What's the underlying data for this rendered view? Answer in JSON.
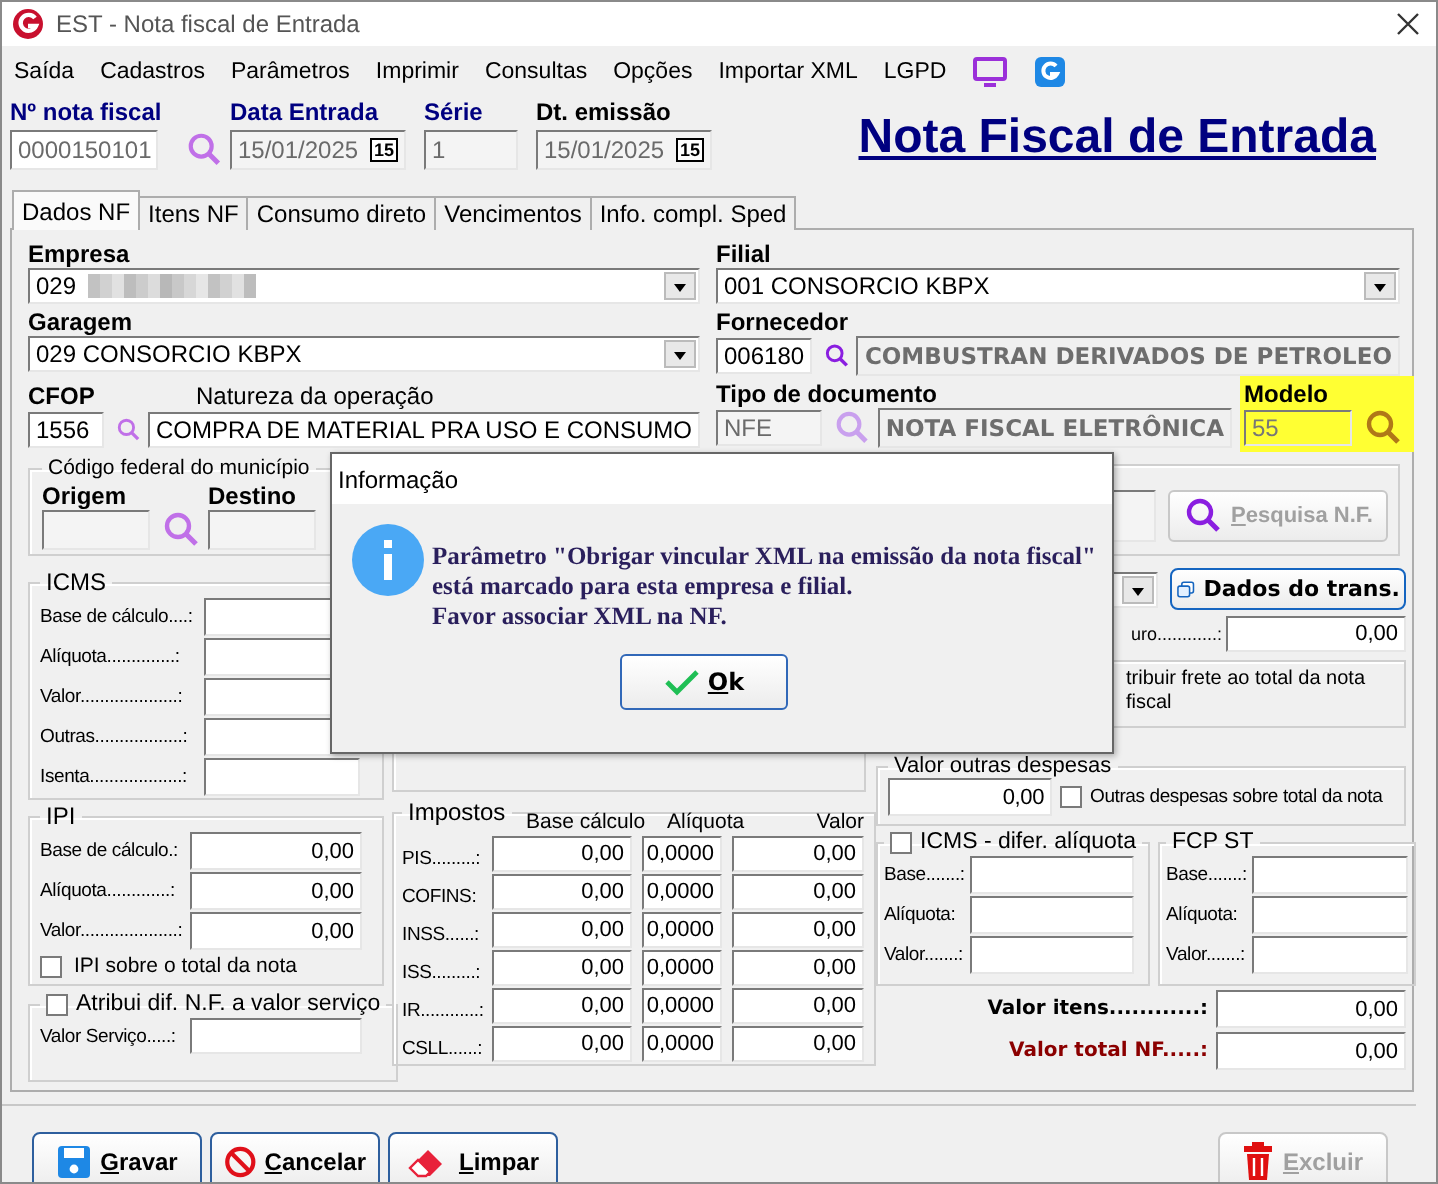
{
  "window": {
    "title": "EST - Nota fiscal de Entrada"
  },
  "menu": [
    "Saída",
    "Cadastros",
    "Parâmetros",
    "Imprimir",
    "Consultas",
    "Opções",
    "Importar XML",
    "LGPD"
  ],
  "header": {
    "fields": [
      {
        "label": "Nº nota fiscal",
        "value": "0000150101",
        "kind": "search",
        "highlighted": true
      },
      {
        "label": "Data Entrada",
        "value": "15/01/2025",
        "kind": "date",
        "highlighted": true,
        "calendar_day": "15"
      },
      {
        "label": "Série",
        "value": "1",
        "kind": "plain",
        "highlighted": true
      },
      {
        "label": "Dt. emissão",
        "value": "15/01/2025",
        "kind": "date",
        "highlighted": false,
        "calendar_day": "15"
      }
    ],
    "title": "Nota Fiscal de Entrada"
  },
  "tabs": [
    {
      "label": "Dados NF",
      "selected": true
    },
    {
      "label": "Itens NF",
      "selected": false
    },
    {
      "label": "Consumo direto",
      "selected": false
    },
    {
      "label": "Vencimentos",
      "selected": false
    },
    {
      "label": "Info. compl. Sped",
      "selected": false
    }
  ],
  "empresa": {
    "label": "Empresa",
    "value": "029",
    "redacted": true
  },
  "filial": {
    "label": "Filial",
    "value": "001 CONSORCIO KBPX"
  },
  "garagem": {
    "label": "Garagem",
    "value": "029 CONSORCIO KBPX"
  },
  "fornecedor": {
    "label": "Fornecedor",
    "code": "006180",
    "name": "COMBUSTRAN DERIVADOS DE PETROLEO"
  },
  "cfop": {
    "label": "CFOP",
    "code": "1556",
    "nature_label": "Natureza da operação",
    "nature": "COMPRA DE MATERIAL PRA USO E CONSUMO"
  },
  "tipo_documento": {
    "label": "Tipo de documento",
    "code": "NFE",
    "name": "NOTA FISCAL ELETRÔNICA"
  },
  "modelo": {
    "label": "Modelo",
    "value": "55",
    "highlighted": true
  },
  "municipio": {
    "title": "Código federal do município",
    "origem_label": "Origem",
    "destino_label": "Destino"
  },
  "pesquisa_button": {
    "label": "Pesquisa N.F.",
    "disabled": true
  },
  "icms": {
    "title": "ICMS",
    "rows": [
      {
        "label": "Base de cálculo....:"
      },
      {
        "label": "Alíquota..............:"
      },
      {
        "label": "Valor....................:"
      },
      {
        "label": "Outras..................:"
      },
      {
        "label": "Isenta...................:"
      }
    ]
  },
  "ipi": {
    "title": "IPI",
    "rows": [
      {
        "label": "Base de cálculo.:",
        "value": "0,00"
      },
      {
        "label": "Alíquota.............:",
        "value": "0,00"
      },
      {
        "label": "Valor....................:",
        "value": "0,00"
      }
    ],
    "checkbox": {
      "label": "IPI sobre o total da nota",
      "checked": false
    }
  },
  "servico": {
    "title": "Atribui dif. N.F. a valor serviço",
    "checked": false,
    "field_label": "Valor Serviço.....:"
  },
  "impostos": {
    "title": "Impostos",
    "columns": [
      "Base cálculo",
      "Alíquota",
      "Valor"
    ],
    "rows": [
      {
        "label": "PIS.........:",
        "values": [
          "0,00",
          "0,0000",
          "0,00"
        ]
      },
      {
        "label": "COFINS:",
        "values": [
          "0,00",
          "0,0000",
          "0,00"
        ]
      },
      {
        "label": "INSS......:",
        "values": [
          "0,00",
          "0,0000",
          "0,00"
        ]
      },
      {
        "label": "ISS.........:",
        "values": [
          "0,00",
          "0,0000",
          "0,00"
        ]
      },
      {
        "label": "IR............:",
        "values": [
          "0,00",
          "0,0000",
          "0,00"
        ]
      },
      {
        "label": "CSLL......:",
        "values": [
          "0,00",
          "0,0000",
          "0,00"
        ]
      }
    ]
  },
  "transporte_button": "Dados do trans.",
  "seguro": {
    "label": "uro............:",
    "value": "0,00"
  },
  "frete_label": "tribuir frete ao total da nota fiscal",
  "outras_despesas": {
    "title": "Valor outras despesas",
    "value": "0,00",
    "checkbox": {
      "label": "Outras despesas sobre total da nota",
      "checked": false
    }
  },
  "icms_difer": {
    "title": "ICMS - difer. alíquota",
    "checked": false,
    "rows": [
      "Base.......:",
      "Alíquota:",
      "Valor.......:"
    ]
  },
  "fcp_st": {
    "title": "FCP ST",
    "rows": [
      "Base.......:",
      "Alíquota:",
      "Valor.......:"
    ]
  },
  "totals": [
    {
      "label": "Valor itens............:",
      "value": "0,00",
      "kind": "normal"
    },
    {
      "label": "Valor total NF.....:",
      "value": "0,00",
      "kind": "grand"
    }
  ],
  "buttons": [
    {
      "label": "Gravar",
      "kind": "save",
      "disabled": false
    },
    {
      "label": "Cancelar",
      "kind": "cancel",
      "disabled": false
    },
    {
      "label": "Limpar",
      "kind": "clear",
      "disabled": false
    },
    {
      "label": "Excluir",
      "kind": "delete",
      "disabled": true
    }
  ],
  "dialog": {
    "title": "Informação",
    "message": "Parâmetro \"Obrigar vincular XML na emissão da nota fiscal\"\nestá marcado para esta empresa e filial.\nFavor associar XML na NF.",
    "button": "Ok"
  }
}
